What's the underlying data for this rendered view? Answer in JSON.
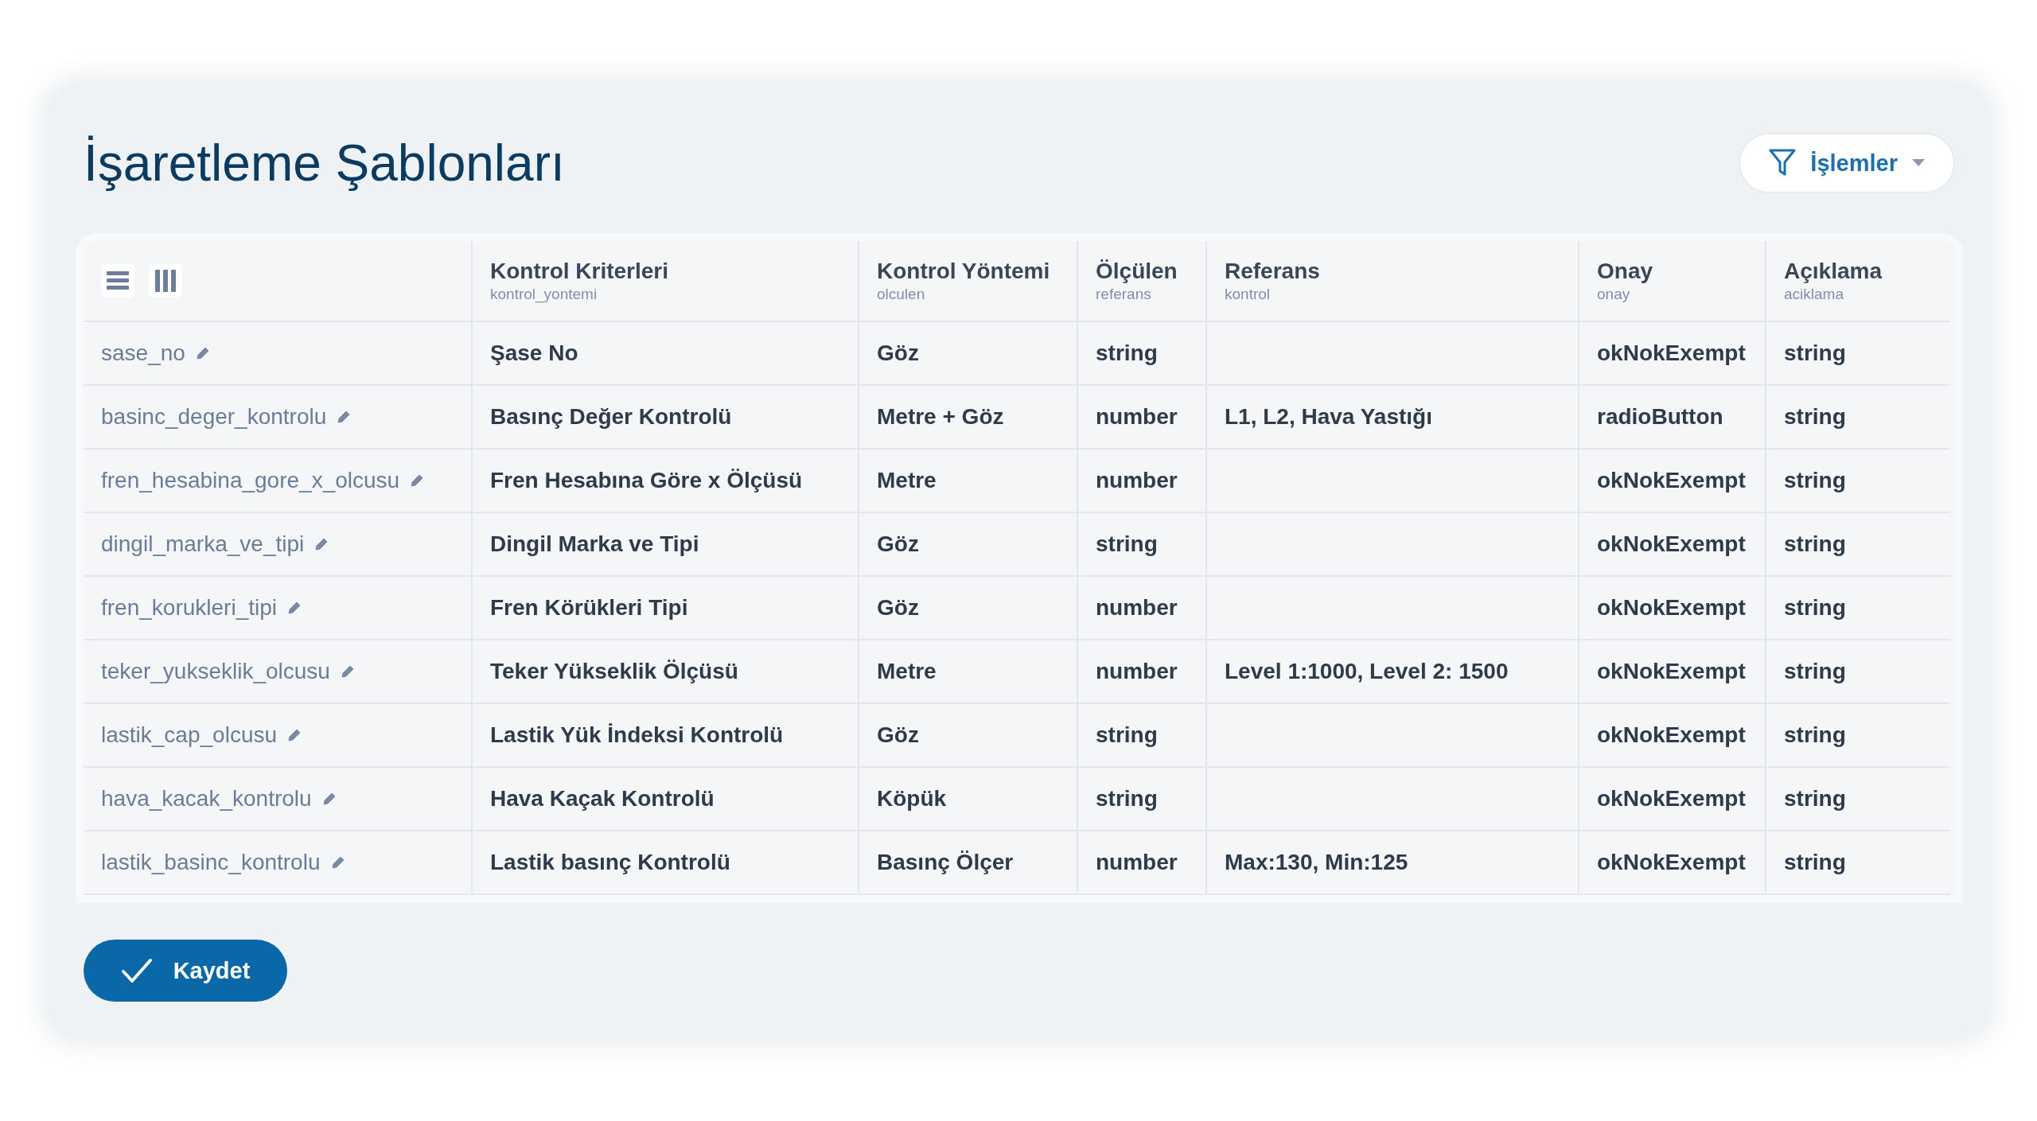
{
  "title": "İşaretleme Şablonları",
  "actions_button": {
    "label": "İşlemler"
  },
  "table": {
    "columns": [
      {
        "label": "Kontrol Kriterleri",
        "key": "kontrol_yontemi"
      },
      {
        "label": "Kontrol Yöntemi",
        "key": "olculen"
      },
      {
        "label": "Ölçülen",
        "key": "referans"
      },
      {
        "label": "Referans",
        "key": "kontrol"
      },
      {
        "label": "Onay",
        "key": "onay"
      },
      {
        "label": "Açıklama",
        "key": "aciklama"
      }
    ],
    "rows": [
      {
        "name": "sase_no",
        "cells": [
          "Şase No",
          "Göz",
          "string",
          "",
          "okNokExempt",
          "string"
        ]
      },
      {
        "name": "basinc_deger_kontrolu",
        "cells": [
          "Basınç Değer Kontrolü",
          "Metre + Göz",
          "number",
          "L1, L2, Hava Yastığı",
          "radioButton",
          "string"
        ]
      },
      {
        "name": "fren_hesabina_gore_x_olcusu",
        "cells": [
          "Fren Hesabına Göre x Ölçüsü",
          "Metre",
          "number",
          "",
          "okNokExempt",
          "string"
        ]
      },
      {
        "name": "dingil_marka_ve_tipi",
        "cells": [
          "Dingil Marka ve Tipi",
          "Göz",
          "string",
          "",
          "okNokExempt",
          "string"
        ]
      },
      {
        "name": "fren_korukleri_tipi",
        "cells": [
          "Fren Körükleri Tipi",
          "Göz",
          "number",
          "",
          "okNokExempt",
          "string"
        ]
      },
      {
        "name": "teker_yukseklik_olcusu",
        "cells": [
          "Teker Yükseklik Ölçüsü",
          "Metre",
          "number",
          "Level 1:1000, Level 2: 1500",
          "okNokExempt",
          "string"
        ]
      },
      {
        "name": "lastik_cap_olcusu",
        "cells": [
          "Lastik Yük İndeksi Kontrolü",
          "Göz",
          "string",
          "",
          "okNokExempt",
          "string"
        ]
      },
      {
        "name": "hava_kacak_kontrolu",
        "cells": [
          "Hava Kaçak Kontrolü",
          "Köpük",
          "string",
          "",
          "okNokExempt",
          "string"
        ]
      },
      {
        "name": "lastik_basinc_kontrolu",
        "cells": [
          "Lastik basınç Kontrolü",
          "Basınç Ölçer",
          "number",
          "Max:130, Min:125",
          "okNokExempt",
          "string"
        ]
      }
    ]
  },
  "save_button": {
    "label": "Kaydet"
  }
}
